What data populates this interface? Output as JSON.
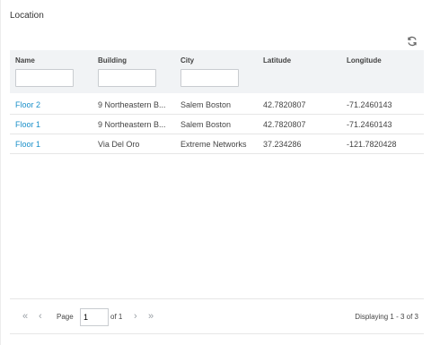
{
  "panel": {
    "title": "Location"
  },
  "icons": {
    "refresh": "refresh-icon"
  },
  "columns": [
    "Name",
    "Building",
    "City",
    "Latitude",
    "Longitude"
  ],
  "filters": {
    "name": "",
    "building": "",
    "city": ""
  },
  "rows": [
    {
      "name": "Floor 2",
      "building": "9 Northeastern B...",
      "city": "Salem Boston",
      "latitude": "42.7820807",
      "longitude": "-71.2460143"
    },
    {
      "name": "Floor 1",
      "building": "9 Northeastern B...",
      "city": "Salem Boston",
      "latitude": "42.7820807",
      "longitude": "-71.2460143"
    },
    {
      "name": "Floor 1",
      "building": "Via Del Oro",
      "city": "Extreme Networks",
      "latitude": "37.234286",
      "longitude": "-121.7820428"
    }
  ],
  "pager": {
    "page_label": "Page",
    "page_value": "1",
    "of_label": "of 1",
    "display_text": "Displaying 1 - 3 of 3"
  },
  "colors": {
    "link": "#1a8fc9",
    "header_bg": "#f1f3f5"
  }
}
